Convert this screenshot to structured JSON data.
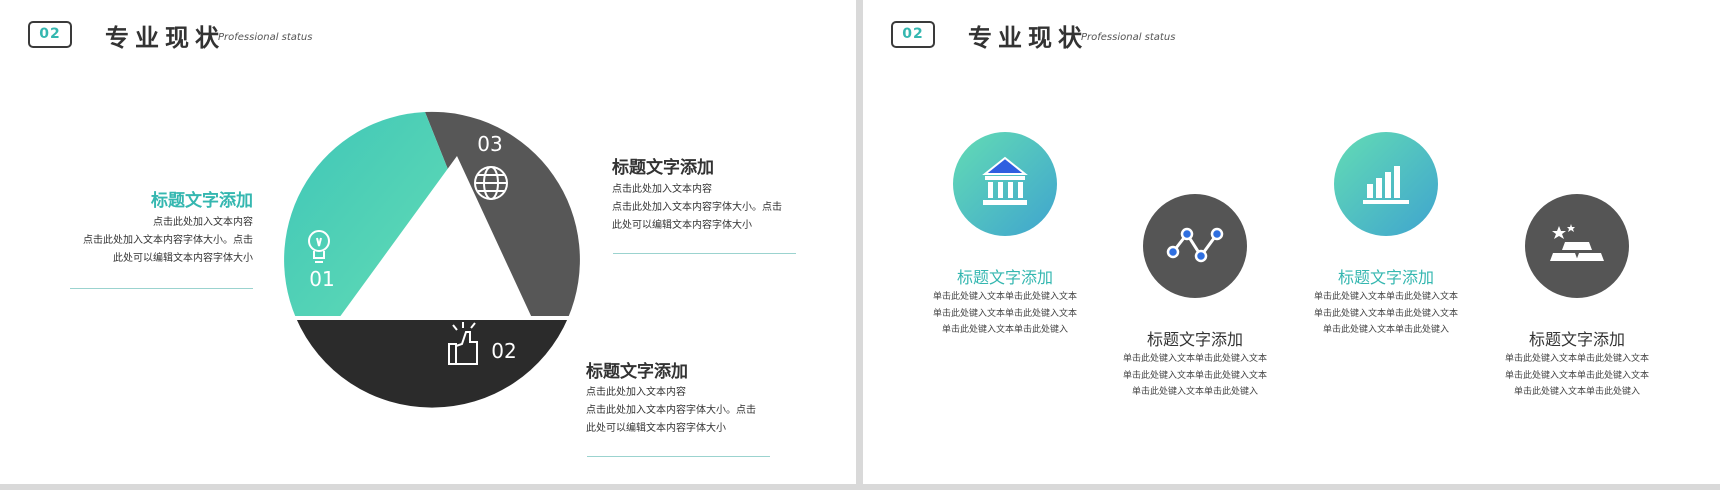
{
  "slide_left": {
    "badge": "02",
    "title": "专业现状",
    "subtitle": "Professional status",
    "segments": [
      {
        "number": "01",
        "icon": "lightbulb-icon",
        "color": "#4fcbbd"
      },
      {
        "number": "02",
        "icon": "thumbs-up-icon",
        "color": "#2b2b2b"
      },
      {
        "number": "03",
        "icon": "globe-icon",
        "color": "#575757"
      }
    ],
    "block_left": {
      "title": "标题文字添加",
      "lines": [
        "点击此处加入文本内容",
        "点击此处加入文本内容字体大小。点击",
        "此处可以编辑文本内容字体大小"
      ]
    },
    "block_top_right": {
      "title": "标题文字添加",
      "lines": [
        "点击此处加入文本内容",
        "点击此处加入文本内容字体大小。点击",
        "此处可以编辑文本内容字体大小"
      ]
    },
    "block_bottom_right": {
      "title": "标题文字添加",
      "lines": [
        "点击此处加入文本内容",
        "点击此处加入文本内容字体大小。点击",
        "此处可以编辑文本内容字体大小"
      ]
    }
  },
  "slide_right": {
    "badge": "02",
    "title": "专业现状",
    "subtitle": "Professional status",
    "features": [
      {
        "title": "标题文字添加",
        "icon": "bank-icon",
        "lines": [
          "单击此处键入文本单击此处键入文本",
          "单击此处键入文本单击此处键入文本",
          "单击此处键入文本单击此处键入"
        ]
      },
      {
        "title": "标题文字添加",
        "icon": "line-nodes-icon",
        "lines": [
          "单击此处键入文本单击此处键入文本",
          "单击此处键入文本单击此处键入文本",
          "单击此处键入文本单击此处键入"
        ]
      },
      {
        "title": "标题文字添加",
        "icon": "bar-chart-icon",
        "lines": [
          "单击此处键入文本单击此处键入文本",
          "单击此处键入文本单击此处键入文本",
          "单击此处键入文本单击此处键入"
        ]
      },
      {
        "title": "标题文字添加",
        "icon": "gold-bars-icon",
        "lines": [
          "单击此处键入文本单击此处键入文本",
          "单击此处键入文本单击此处键入文本",
          "单击此处键入文本单击此处键入"
        ]
      }
    ]
  },
  "colors": {
    "accent": "#4fcbbd",
    "accent_text": "#35b7b0",
    "dark": "#2b2b2b",
    "mid": "#575757"
  }
}
